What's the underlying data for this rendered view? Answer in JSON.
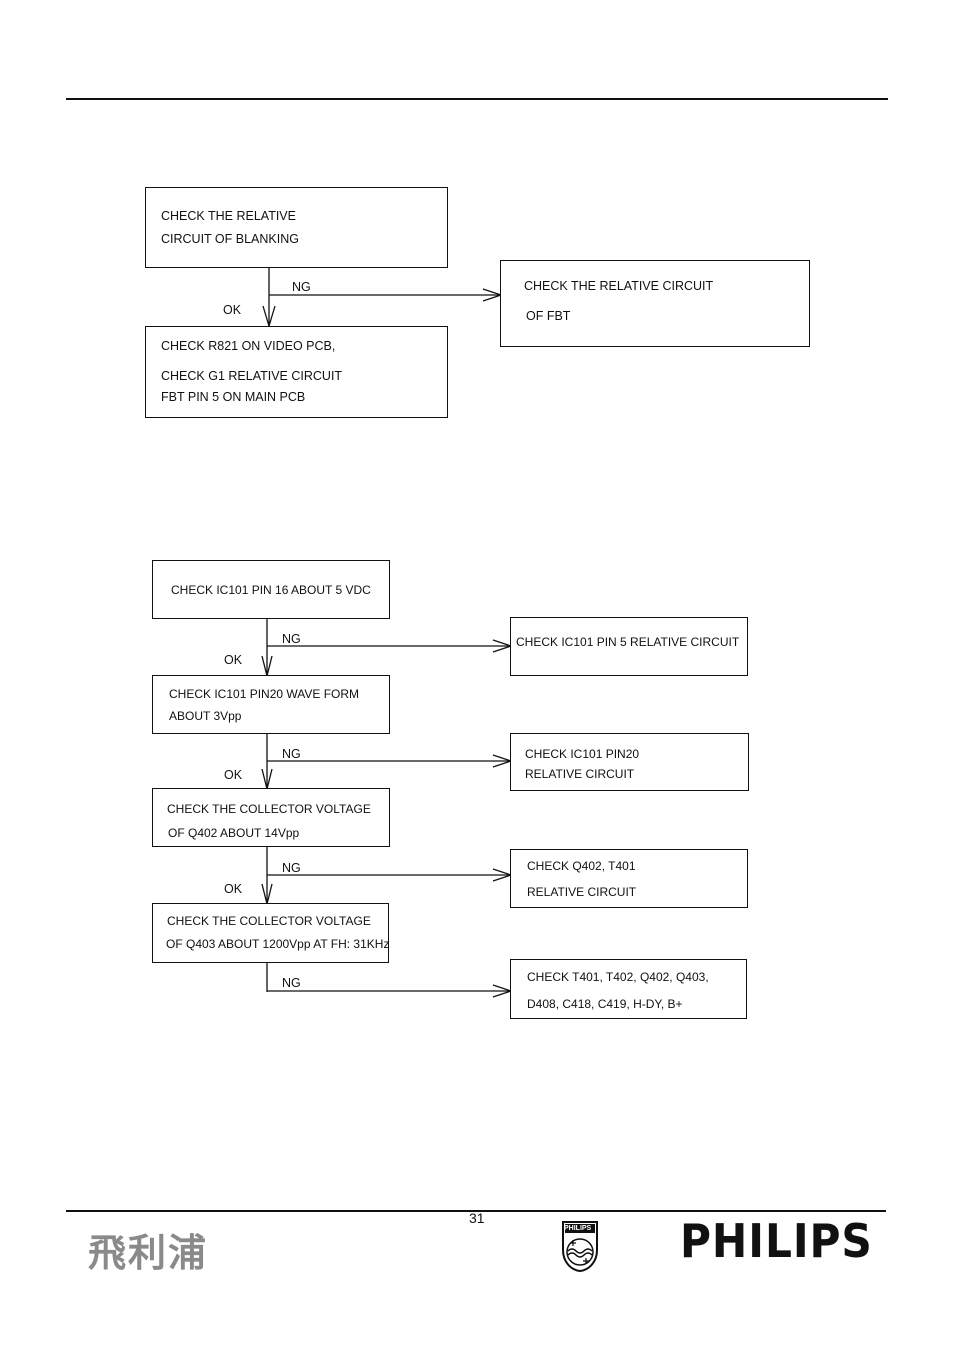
{
  "page_number": "31",
  "footer": {
    "chinese_brand": "飛利浦",
    "brand": "PHILIPS",
    "shield_text": "PHILIPS"
  },
  "flow1": {
    "start": [
      "CHECK THE RELATIVE",
      "CIRCUIT OF BLANKING"
    ],
    "ng_label": "NG",
    "ok_label": "OK",
    "ng_box": [
      "CHECK THE RELATIVE CIRCUIT",
      "OF FBT"
    ],
    "ok_box": [
      "CHECK R821 ON VIDEO PCB,",
      "CHECK G1 RELATIVE CIRCUIT",
      "FBT PIN 5 ON MAIN PCB"
    ]
  },
  "flow2": {
    "steps": [
      {
        "check": [
          "CHECK IC101 PIN 16 ABOUT 5 VDC"
        ],
        "ng": [
          "CHECK IC101 PIN 5 RELATIVE CIRCUIT"
        ],
        "ng_label": "NG",
        "ok_label": "OK"
      },
      {
        "check": [
          "CHECK IC101 PIN20 WAVE FORM",
          "ABOUT 3Vpp"
        ],
        "ng": [
          "CHECK IC101 PIN20",
          "RELATIVE CIRCUIT"
        ],
        "ng_label": "NG",
        "ok_label": "OK"
      },
      {
        "check": [
          "CHECK THE COLLECTOR VOLTAGE",
          "OF Q402 ABOUT 14Vpp"
        ],
        "ng": [
          "CHECK Q402, T401",
          "RELATIVE CIRCUIT"
        ],
        "ng_label": "NG",
        "ok_label": "OK"
      },
      {
        "check": [
          "CHECK THE COLLECTOR VOLTAGE",
          "OF Q403 ABOUT 1200Vpp AT FH: 31KHz"
        ],
        "ng": [
          "CHECK T401, T402, Q402, Q403,",
          "D408, C418, C419, H-DY, B+"
        ],
        "ng_label": "NG"
      }
    ]
  }
}
